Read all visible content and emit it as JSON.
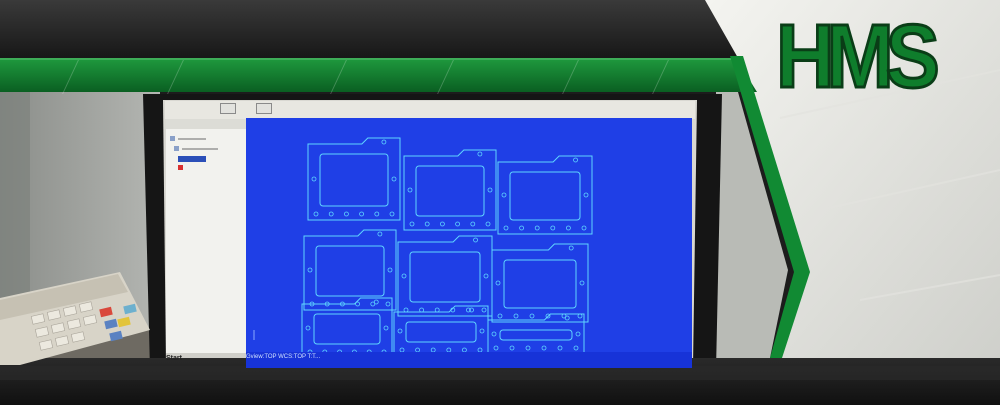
{
  "brand": {
    "logo_text": "HMS",
    "color_green": "#0f7d2c",
    "color_green_dark": "#0a3d17"
  },
  "cad": {
    "statusbar_text": "Gview:TOP   WCS:TOP   T:T...",
    "start_label": "Start",
    "viewport_color": "#1f3fe6",
    "linework_color": "#5fd6ff",
    "icons": [
      "view-icon",
      "snap-icon",
      "zoom-icon",
      "pan-icon",
      "rotate-icon",
      "shade-icon",
      "wireframe-icon",
      "help-icon"
    ]
  },
  "scene": {
    "objects": [
      "desk-calculator",
      "computer-monitor",
      "cad-program-window"
    ]
  }
}
